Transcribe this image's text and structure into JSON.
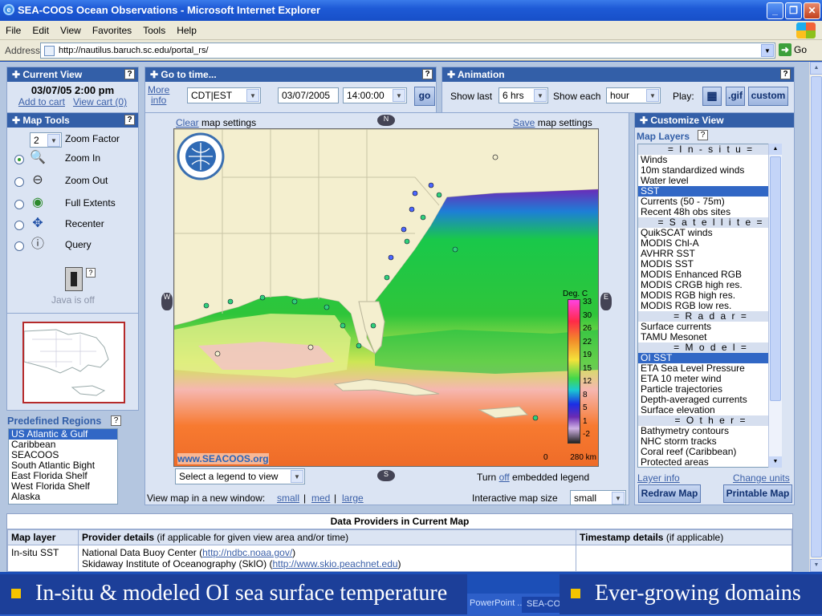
{
  "window": {
    "title": "SEA-COOS Ocean Observations - Microsoft Internet Explorer"
  },
  "menu": [
    "File",
    "Edit",
    "View",
    "Favorites",
    "Tools",
    "Help"
  ],
  "address": {
    "label": "Address",
    "url": "http://nautilus.baruch.sc.edu/portal_rs/",
    "go": "Go"
  },
  "current_view": {
    "header": "Current View",
    "datetime": "03/07/05 2:00 pm",
    "add_cart": "Add to cart",
    "view_cart": "View cart (0)"
  },
  "goto": {
    "header": "Go to time...",
    "more": "More",
    "info": "info",
    "timezone": "CDT|EST",
    "date": "03/07/2005",
    "time": "14:00:00",
    "go": "go"
  },
  "animation": {
    "header": "Animation",
    "show_last_label": "Show last",
    "show_last": "6 hrs",
    "show_each_label": "Show each",
    "show_each": "hour",
    "play_label": "Play:",
    "gif": ".gif",
    "custom": "custom"
  },
  "map_tools": {
    "header": "Map Tools",
    "zoom_factor_value": "2",
    "zoom_factor": "Zoom Factor",
    "tools": [
      "Zoom In",
      "Zoom Out",
      "Full Extents",
      "Recenter",
      "Query"
    ],
    "java": "Java is off"
  },
  "regions": {
    "header": "Predefined Regions",
    "items": [
      "US Atlantic & Gulf",
      "Caribbean",
      "SEACOOS",
      "South Atlantic Bight",
      "East Florida Shelf",
      "West Florida Shelf",
      "Alaska"
    ]
  },
  "map": {
    "clear": "Clear",
    "clear_rest": "map settings",
    "save": "Save",
    "save_rest": "map settings",
    "logo_text": "www.SEACOOS.org",
    "legend_title": "Deg. C",
    "legend_ticks": [
      "33",
      "30",
      "26",
      "22",
      "19",
      "15",
      "12",
      "8",
      "5",
      "1",
      "-2"
    ],
    "scale_0": "0",
    "scale_1": "280 km",
    "legend_select": "Select a legend to view",
    "turn": "Turn",
    "off": "off",
    "embedded": "embedded legend",
    "new_window": "View map in a new window:",
    "small": "small",
    "med": "med",
    "large": "large",
    "size_label": "Interactive map size",
    "size": "small"
  },
  "customize": {
    "header": "Customize View",
    "layers_label": "Map Layers",
    "layers": [
      {
        "t": "= I n - s i t u =",
        "k": "hd"
      },
      {
        "t": "Winds"
      },
      {
        "t": "10m standardized winds"
      },
      {
        "t": "Water level"
      },
      {
        "t": "SST",
        "k": "hi"
      },
      {
        "t": "Currents (50 - 75m)"
      },
      {
        "t": "Recent 48h obs sites"
      },
      {
        "t": "= S a t e l l i t e =",
        "k": "hd"
      },
      {
        "t": "QuikSCAT winds"
      },
      {
        "t": "MODIS Chl-A"
      },
      {
        "t": "AVHRR SST"
      },
      {
        "t": "MODIS SST"
      },
      {
        "t": "MODIS Enhanced RGB"
      },
      {
        "t": "MODIS CRGB high res."
      },
      {
        "t": "MODIS RGB high res."
      },
      {
        "t": "MODIS RGB low res."
      },
      {
        "t": "= R a d a r =",
        "k": "hd"
      },
      {
        "t": "Surface currents"
      },
      {
        "t": "TAMU Mesonet"
      },
      {
        "t": "= M o d e l =",
        "k": "hd"
      },
      {
        "t": "OI SST",
        "k": "hi"
      },
      {
        "t": "ETA Sea Level Pressure"
      },
      {
        "t": "ETA 10 meter wind"
      },
      {
        "t": "Particle trajectories"
      },
      {
        "t": "Depth-averaged currents"
      },
      {
        "t": "Surface elevation"
      },
      {
        "t": "= O t h e r =",
        "k": "hd"
      },
      {
        "t": "Bathymetry contours"
      },
      {
        "t": "NHC storm tracks"
      },
      {
        "t": "Coral reef (Caribbean)"
      },
      {
        "t": "Protected areas"
      }
    ],
    "layer_info": "Layer info",
    "change_units": "Change units",
    "redraw": "Redraw Map",
    "printable": "Printable Map"
  },
  "providers": {
    "title": "Data Providers in Current Map",
    "h1": "Map layer",
    "h2a": "Provider details",
    "h2b": "(if applicable for given view area and/or time)",
    "h3a": "Timestamp details",
    "h3b": "(if applicable)",
    "layer": "In-situ SST",
    "p1": "National Data Buoy Center (",
    "p1link": "http://ndbc.noaa.gov/",
    "p1end": ")",
    "p2": "Skidaway Institute of Oceanography (SkIO) (",
    "p2link": "http://www.skio.peachnet.edu",
    "p2end": ")"
  },
  "slide": {
    "left": "In-situ & modeled OI sea surface temperature",
    "right": "Ever-growing domains"
  },
  "taskbar": {
    "item1": "PowerPoint ...",
    "item2": "SEA-COOS Ocean..."
  },
  "colors": {
    "panel_head": "#335fa8",
    "band": "#1c3f99",
    "bullet": "#f4c400"
  }
}
